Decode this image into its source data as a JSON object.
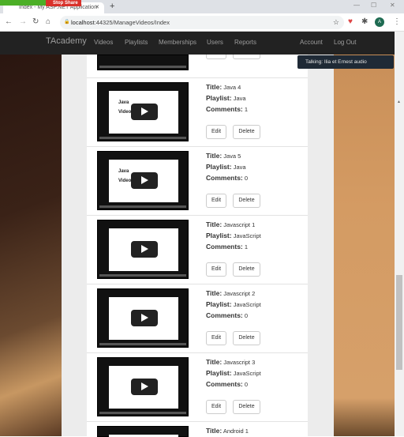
{
  "browser": {
    "tab_title": "Index - My ASP.NET Application",
    "url_host": "localhost",
    "url_path": ":44325/ManageVideos/Index",
    "stop_share": "Stop Share",
    "avatar": "A"
  },
  "nav": {
    "brand": "TAcademy",
    "links": [
      "Videos",
      "Playlists",
      "Memberships",
      "Users",
      "Reports"
    ],
    "account": "Account",
    "logout": "Log Out"
  },
  "talking": "Talking: Ilia et Ernest audio",
  "labels": {
    "title": "Title:",
    "playlist": "Playlist:",
    "comments": "Comments:",
    "edit": "Edit",
    "delete": "Delete"
  },
  "videos": [
    {
      "title": "Java 4",
      "playlist": "Java",
      "comments": "1",
      "thumb": [
        "Java",
        "Video 4"
      ]
    },
    {
      "title": "Java 5",
      "playlist": "Java",
      "comments": "0",
      "thumb": [
        "Java",
        "Video 5"
      ]
    },
    {
      "title": "Javascript 1",
      "playlist": "JavaScript",
      "comments": "1",
      "thumb": [
        "",
        ""
      ]
    },
    {
      "title": "Javascript 2",
      "playlist": "JavaScript",
      "comments": "0",
      "thumb": [
        "",
        ""
      ]
    },
    {
      "title": "Javascript 3",
      "playlist": "JavaScript",
      "comments": "0",
      "thumb": [
        "",
        ""
      ]
    },
    {
      "title": "Android 1",
      "playlist": "",
      "comments": "",
      "thumb": [
        "",
        ""
      ]
    }
  ]
}
